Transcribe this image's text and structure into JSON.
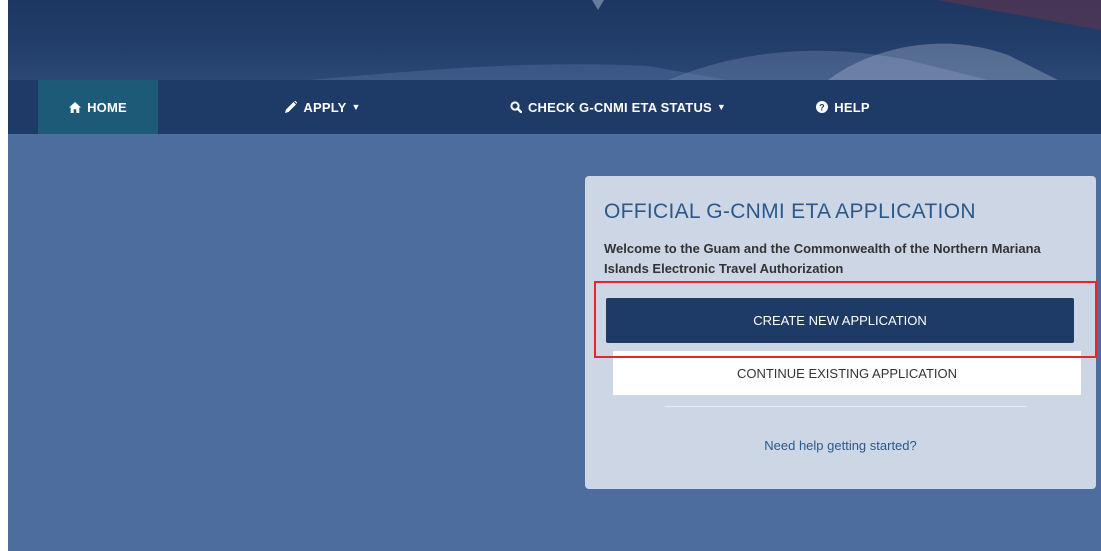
{
  "nav": {
    "home": {
      "label": "HOME",
      "icon": "home-icon"
    },
    "apply": {
      "label": "APPLY",
      "icon": "pencil-icon"
    },
    "check_status": {
      "label": "CHECK G-CNMI ETA STATUS",
      "icon": "search-icon"
    },
    "help": {
      "label": "HELP",
      "icon": "question-circle-icon"
    }
  },
  "card": {
    "title": "OFFICIAL G-CNMI ETA APPLICATION",
    "welcome_text": "Welcome to the Guam and the Commonwealth of the Northern Mariana Islands Electronic Travel Authorization",
    "create_button": "CREATE NEW APPLICATION",
    "continue_button": "CONTINUE EXISTING APPLICATION",
    "help_link": "Need help getting started?"
  },
  "colors": {
    "page_background": "#4d6d9f",
    "navbar": "#1e3a66",
    "nav_active": "#1d5a78",
    "card_background": "#cdd6e5",
    "primary_button": "#1e3a66",
    "title_text": "#2b5a8a",
    "highlight": "#e8252a"
  }
}
